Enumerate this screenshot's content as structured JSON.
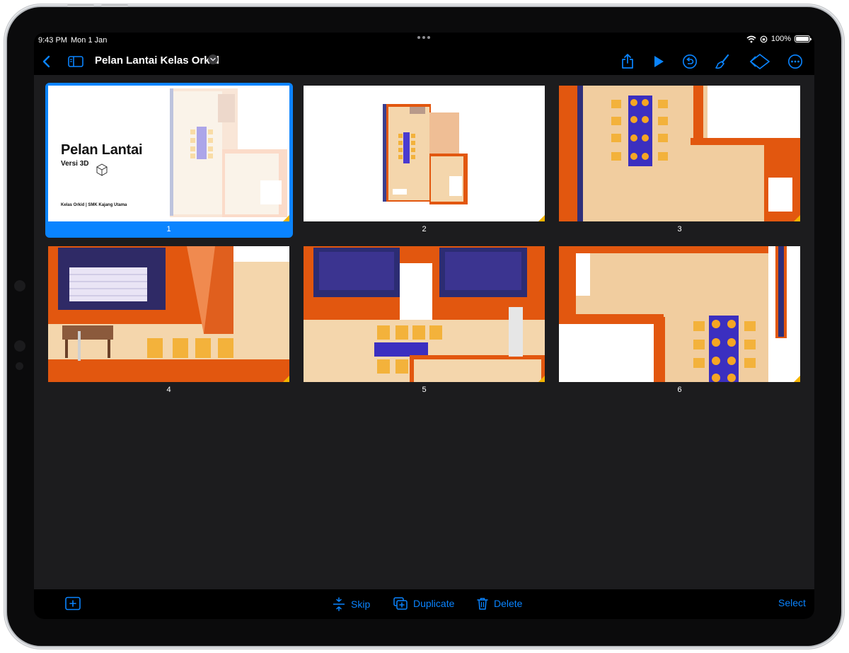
{
  "status": {
    "time": "9:43 PM",
    "date": "Mon 1 Jan",
    "battery": "100%"
  },
  "nav": {
    "title": "Pelan Lantai Kelas Orkid"
  },
  "slides": [
    {
      "number": "1",
      "selected": true,
      "title": "Pelan Lantai",
      "subtitle": "Versi 3D",
      "footer": "Kelas Orkid | SMK Kajang Utama"
    },
    {
      "number": "2",
      "selected": false
    },
    {
      "number": "3",
      "selected": false
    },
    {
      "number": "4",
      "selected": false
    },
    {
      "number": "5",
      "selected": false
    },
    {
      "number": "6",
      "selected": false
    }
  ],
  "toolbar": {
    "skip": "Skip",
    "duplicate": "Duplicate",
    "delete": "Delete",
    "select": "Select"
  },
  "colors": {
    "accent": "#0a84ff",
    "wall": "#e2570f",
    "floor": "#f4d6ac",
    "background": "#1c1c1e"
  }
}
